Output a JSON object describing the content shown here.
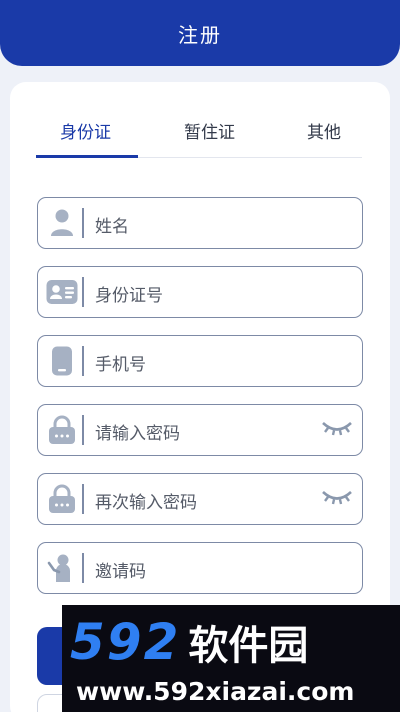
{
  "header": {
    "title": "注册"
  },
  "tabs": [
    {
      "label": "身份证",
      "active": true
    },
    {
      "label": "暂住证",
      "active": false
    },
    {
      "label": "其他",
      "active": false
    }
  ],
  "form": {
    "name_placeholder": "姓名",
    "id_placeholder": "身份证号",
    "phone_placeholder": "手机号",
    "password_placeholder": "请输入密码",
    "password_confirm_placeholder": "再次输入密码",
    "invite_placeholder": "邀请码"
  },
  "icons": {
    "name": "person-icon",
    "id": "id-card-icon",
    "phone": "phone-icon",
    "password": "lock-icon",
    "password_confirm": "lock-icon",
    "invite": "invite-icon",
    "eye": "eye-closed-icon"
  },
  "watermark": {
    "logo_number": "592",
    "logo_text": "软件园",
    "url": "www.592xiazai.com"
  },
  "colors": {
    "primary": "#1a3aa8",
    "border": "#7d8aa6",
    "background": "#eef1f8",
    "icon": "#a6b1c3"
  }
}
